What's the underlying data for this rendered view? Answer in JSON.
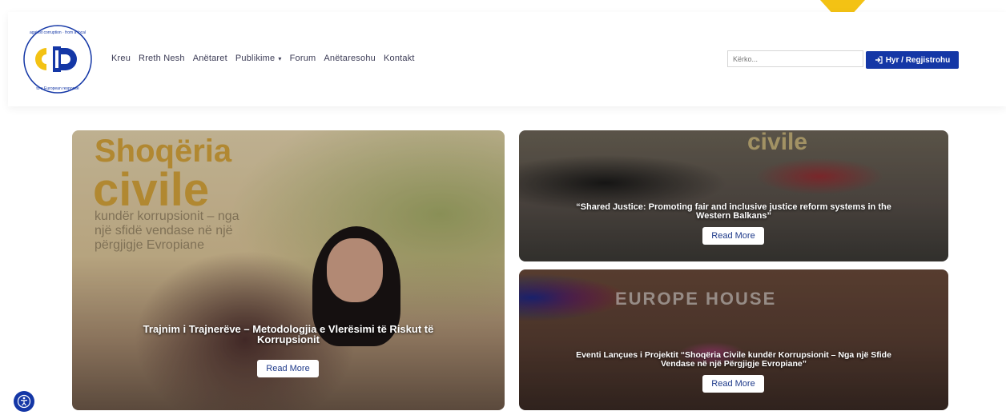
{
  "logo": {
    "ring_text": "civil society against corruption – from a local challenge to a European response"
  },
  "nav": {
    "items": [
      {
        "label": "Kreu"
      },
      {
        "label": "Rreth Nesh"
      },
      {
        "label": "Anëtaret"
      },
      {
        "label": "Publikime",
        "dropdown": true
      },
      {
        "label": "Forum"
      },
      {
        "label": "Anëtaresohu"
      },
      {
        "label": "Kontakt"
      }
    ],
    "dropdown_icon": "chevron-down-icon"
  },
  "search": {
    "placeholder": "Kërko..."
  },
  "login": {
    "label": "Hyr / Regjistrohu",
    "icon": "sign-in-icon"
  },
  "colors": {
    "brand_blue": "#1437a6",
    "accent_yellow": "#f3c214"
  },
  "cards": {
    "main": {
      "title": "Trajnim i Trajnerëve – Metodologjia e Vlerësimi të Riskut të Korrupsionit",
      "button": "Read More",
      "sign_text": [
        "Shoqëria",
        "civile",
        "kundër korrupsionit – nga",
        "një sfidë vendase në një",
        "përgjigje Evropiane"
      ]
    },
    "top_right": {
      "title": "“Shared Justice: Promoting fair and inclusive justice reform systems in the Western Balkans”",
      "button": "Read More"
    },
    "bottom_right": {
      "title": "Eventi Lançues i Projektit “Shoqëria Civile kundër Korrupsionit – Nga një Sfide Vendase në një Përgjigje Evropiane”",
      "button": "Read More",
      "sign_text": "EUROPE HOUSE"
    }
  },
  "accessibility": {
    "icon": "accessibility-icon"
  }
}
